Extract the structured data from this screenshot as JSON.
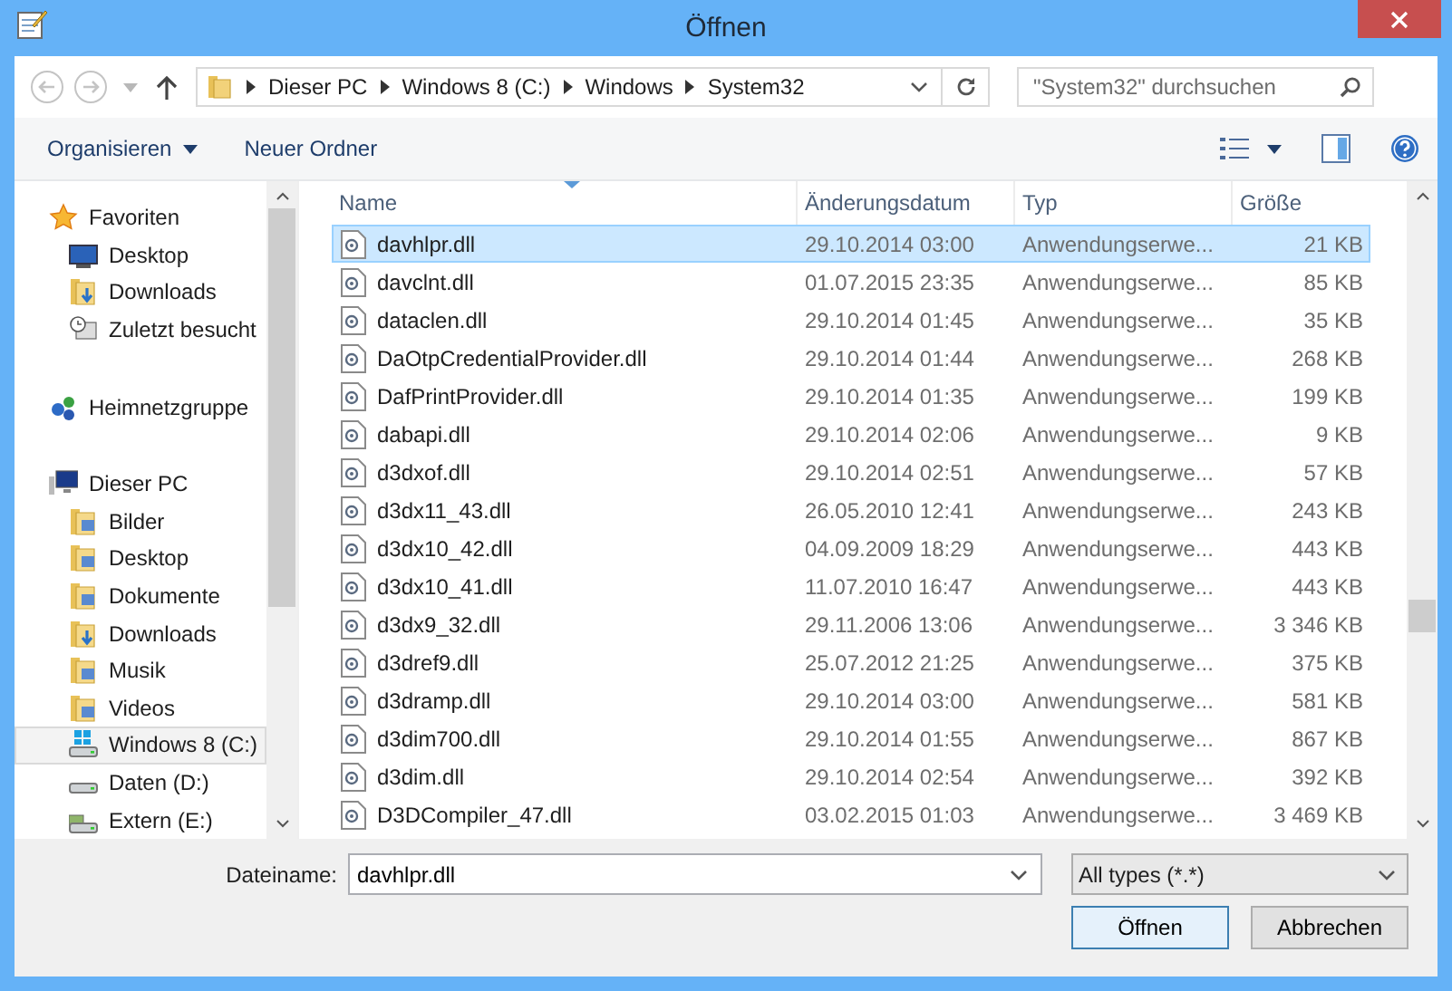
{
  "window": {
    "title": "Öffnen"
  },
  "navigation": {
    "back_disabled": true,
    "forward_disabled": true,
    "breadcrumb": [
      "Dieser PC",
      "Windows 8 (C:)",
      "Windows",
      "System32"
    ],
    "search": {
      "placeholder": "\"System32\" durchsuchen"
    }
  },
  "toolbar": {
    "buttons": [
      "Organisieren",
      "Neuer Ordner"
    ]
  },
  "sidebar": {
    "groups": [
      {
        "label": "Favoriten",
        "selected": false,
        "children": [
          {
            "label": "Desktop",
            "selected": false
          },
          {
            "label": "Downloads",
            "selected": false
          },
          {
            "label": "Zuletzt besucht",
            "selected": false
          }
        ]
      },
      {
        "label": "Heimnetzgruppe",
        "selected": false
      },
      {
        "label": "Dieser PC",
        "selected": false,
        "children": [
          {
            "label": "Bilder",
            "selected": false
          },
          {
            "label": "Desktop",
            "selected": false
          },
          {
            "label": "Dokumente",
            "selected": false
          },
          {
            "label": "Downloads",
            "selected": false
          },
          {
            "label": "Musik",
            "selected": false
          },
          {
            "label": "Videos",
            "selected": false
          },
          {
            "label": "Windows 8 (C:)",
            "selected": true
          },
          {
            "label": "Daten (D:)",
            "selected": false
          },
          {
            "label": "Extern (E:)",
            "selected": false
          }
        ]
      }
    ]
  },
  "table": {
    "columns": [
      {
        "label": "Name",
        "sorted": true
      },
      {
        "label": "Änderungsdatum",
        "sorted": false
      },
      {
        "label": "Typ",
        "sorted": false
      },
      {
        "label": "Größe",
        "sorted": false
      }
    ],
    "rows": [
      {
        "name": "davhlpr.dll",
        "date": "29.10.2014 03:00",
        "type": "Anwendungserwe...",
        "size": "21 KB",
        "selected": true
      },
      {
        "name": "davclnt.dll",
        "date": "01.07.2015 23:35",
        "type": "Anwendungserwe...",
        "size": "85 KB",
        "selected": false
      },
      {
        "name": "dataclen.dll",
        "date": "29.10.2014 01:45",
        "type": "Anwendungserwe...",
        "size": "35 KB",
        "selected": false
      },
      {
        "name": "DaOtpCredentialProvider.dll",
        "date": "29.10.2014 01:44",
        "type": "Anwendungserwe...",
        "size": "268 KB",
        "selected": false
      },
      {
        "name": "DafPrintProvider.dll",
        "date": "29.10.2014 01:35",
        "type": "Anwendungserwe...",
        "size": "199 KB",
        "selected": false
      },
      {
        "name": "dabapi.dll",
        "date": "29.10.2014 02:06",
        "type": "Anwendungserwe...",
        "size": "9 KB",
        "selected": false
      },
      {
        "name": "d3dxof.dll",
        "date": "29.10.2014 02:51",
        "type": "Anwendungserwe...",
        "size": "57 KB",
        "selected": false
      },
      {
        "name": "d3dx11_43.dll",
        "date": "26.05.2010 12:41",
        "type": "Anwendungserwe...",
        "size": "243 KB",
        "selected": false
      },
      {
        "name": "d3dx10_42.dll",
        "date": "04.09.2009 18:29",
        "type": "Anwendungserwe...",
        "size": "443 KB",
        "selected": false
      },
      {
        "name": "d3dx10_41.dll",
        "date": "11.07.2010 16:47",
        "type": "Anwendungserwe...",
        "size": "443 KB",
        "selected": false
      },
      {
        "name": "d3dx9_32.dll",
        "date": "29.11.2006 13:06",
        "type": "Anwendungserwe...",
        "size": "3 346 KB",
        "selected": false
      },
      {
        "name": "d3dref9.dll",
        "date": "25.07.2012 21:25",
        "type": "Anwendungserwe...",
        "size": "375 KB",
        "selected": false
      },
      {
        "name": "d3dramp.dll",
        "date": "29.10.2014 03:00",
        "type": "Anwendungserwe...",
        "size": "581 KB",
        "selected": false
      },
      {
        "name": "d3dim700.dll",
        "date": "29.10.2014 01:55",
        "type": "Anwendungserwe...",
        "size": "867 KB",
        "selected": false
      },
      {
        "name": "d3dim.dll",
        "date": "29.10.2014 02:54",
        "type": "Anwendungserwe...",
        "size": "392 KB",
        "selected": false
      },
      {
        "name": "D3DCompiler_47.dll",
        "date": "03.02.2015 01:03",
        "type": "Anwendungserwe...",
        "size": "3 469 KB",
        "selected": false
      }
    ]
  },
  "footer": {
    "filename_label": "Dateiname:",
    "filename": "davhlpr.dll",
    "filter": "All types (*.*)",
    "buttons": [
      {
        "label": "Öffnen",
        "default": true
      },
      {
        "label": "Abbrechen",
        "default": false
      }
    ]
  }
}
